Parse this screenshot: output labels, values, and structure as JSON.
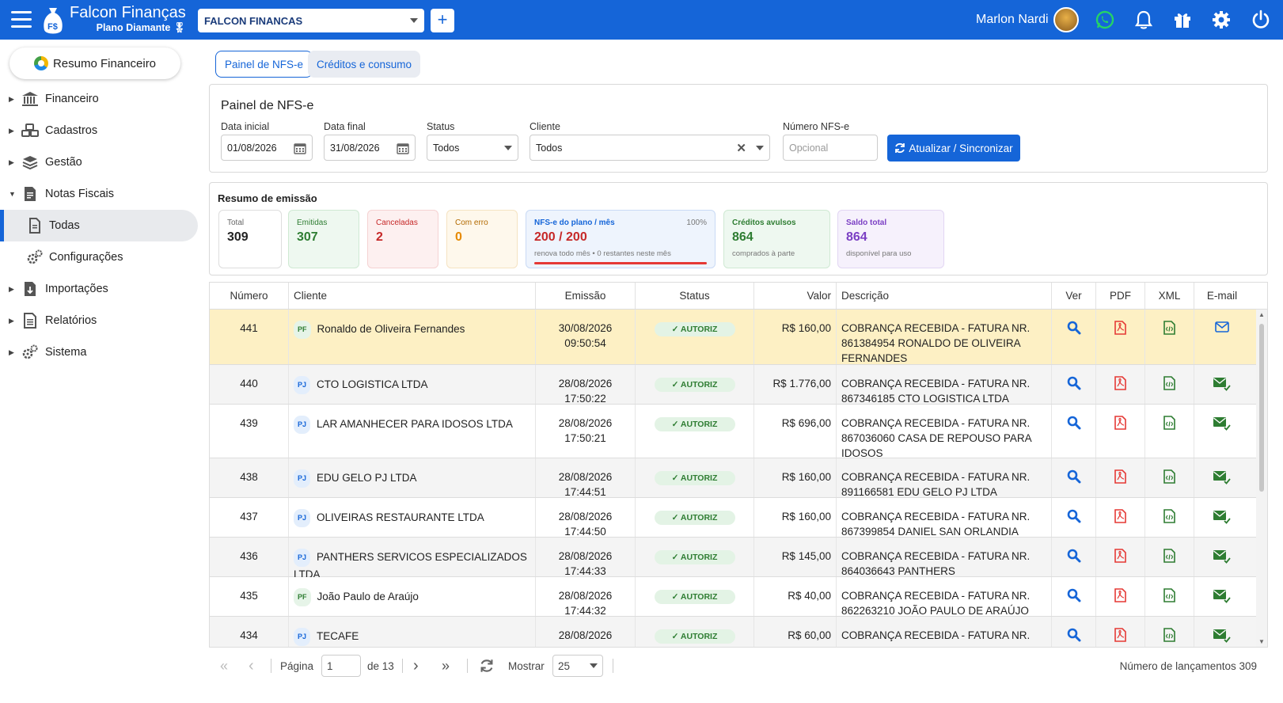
{
  "app": {
    "brand_name": "Falcon Finanças",
    "plan": "Plano Diamante",
    "company": "FALCON FINANCAS",
    "user_name": "Marlon Nardi"
  },
  "sidebar": {
    "resumo": "Resumo Financeiro",
    "items": [
      {
        "label": "Financeiro"
      },
      {
        "label": "Cadastros"
      },
      {
        "label": "Gestão"
      },
      {
        "label": "Notas Fiscais"
      },
      {
        "label": "Todas"
      },
      {
        "label": "Configurações"
      },
      {
        "label": "Importações"
      },
      {
        "label": "Relatórios"
      },
      {
        "label": "Sistema"
      }
    ]
  },
  "tabs": [
    {
      "label": "Painel de NFS-e"
    },
    {
      "label": "Créditos e consumo"
    }
  ],
  "filters": {
    "title": "Painel de NFS-e",
    "data_inicial_label": "Data inicial",
    "data_inicial": "01/08/2026",
    "data_final_label": "Data final",
    "data_final": "31/08/2026",
    "status_label": "Status",
    "status": "Todos",
    "cliente_label": "Cliente",
    "cliente": "Todos",
    "numero_label": "Número NFS-e",
    "numero_placeholder": "Opcional",
    "sync_button": "Atualizar / Sincronizar"
  },
  "summary": {
    "title": "Resumo de emissão",
    "total_label": "Total",
    "total": "309",
    "emitidas_label": "Emitidas",
    "emitidas": "307",
    "canceladas_label": "Canceladas",
    "canceladas": "2",
    "erro_label": "Com erro",
    "erro": "0",
    "plano_label": "NFS-e do plano / mês",
    "plano_pct": "100%",
    "plano_value": "200 / 200",
    "plano_sub": "renova todo mês • 0 restantes neste mês",
    "plano_usage": 1.0,
    "avulsos_label": "Créditos avulsos",
    "avulsos": "864",
    "avulsos_sub": "comprados à parte",
    "saldo_label": "Saldo total",
    "saldo": "864",
    "saldo_sub": "disponível para uso"
  },
  "table": {
    "headers": {
      "numero": "Número",
      "cliente": "Cliente",
      "emissao": "Emissão",
      "status": "Status",
      "valor": "Valor",
      "descricao": "Descrição",
      "ver": "Ver",
      "pdf": "PDF",
      "xml": "XML",
      "email": "E-mail"
    },
    "rows": [
      {
        "numero": "441",
        "tipo": "PF",
        "cliente": "Ronaldo de Oliveira Fernandes",
        "data": "30/08/2026",
        "hora": "09:50:54",
        "status": "✓ AUTORIZ",
        "valor": "R$ 160,00",
        "descricao": "COBRANÇA RECEBIDA - FATURA NR. 861384954 RONALDO DE OLIVEIRA FERNANDES"
      },
      {
        "numero": "440",
        "tipo": "PJ",
        "cliente": "CTO LOGISTICA LTDA",
        "data": "28/08/2026",
        "hora": "17:50:22",
        "status": "✓ AUTORIZ",
        "valor": "R$ 1.776,00",
        "descricao": "COBRANÇA RECEBIDA - FATURA NR. 867346185 CTO LOGISTICA LTDA"
      },
      {
        "numero": "439",
        "tipo": "PJ",
        "cliente": "LAR AMANHECER PARA IDOSOS LTDA",
        "data": "28/08/2026",
        "hora": "17:50:21",
        "status": "✓ AUTORIZ",
        "valor": "R$ 696,00",
        "descricao": "COBRANÇA RECEBIDA - FATURA NR. 867036060 CASA DE REPOUSO PARA IDOSOS"
      },
      {
        "numero": "438",
        "tipo": "PJ",
        "cliente": "EDU GELO PJ LTDA",
        "data": "28/08/2026",
        "hora": "17:44:51",
        "status": "✓ AUTORIZ",
        "valor": "R$ 160,00",
        "descricao": "COBRANÇA RECEBIDA - FATURA NR. 891166581 EDU GELO PJ LTDA"
      },
      {
        "numero": "437",
        "tipo": "PJ",
        "cliente": "OLIVEIRAS RESTAURANTE LTDA",
        "data": "28/08/2026",
        "hora": "17:44:50",
        "status": "✓ AUTORIZ",
        "valor": "R$ 160,00",
        "descricao": "COBRANÇA RECEBIDA - FATURA NR. 867399854 DANIEL SAN ORLANDIA"
      },
      {
        "numero": "436",
        "tipo": "PJ",
        "cliente": "PANTHERS SERVICOS ESPECIALIZADOS LTDA",
        "data": "28/08/2026",
        "hora": "17:44:33",
        "status": "✓ AUTORIZ",
        "valor": "R$ 145,00",
        "descricao": "COBRANÇA RECEBIDA - FATURA NR. 864036643 PANTHERS"
      },
      {
        "numero": "435",
        "tipo": "PF",
        "cliente": "João Paulo de Araújo",
        "data": "28/08/2026",
        "hora": "17:44:32",
        "status": "✓ AUTORIZ",
        "valor": "R$ 40,00",
        "descricao": "COBRANÇA RECEBIDA - FATURA NR. 862263210 JOÃO PAULO DE ARAÚJO"
      },
      {
        "numero": "434",
        "tipo": "PJ",
        "cliente": "TECAFE INCORPORACOES,CONSTRUCOES E",
        "data": "28/08/2026",
        "hora": "",
        "status": "✓ AUTORIZ",
        "valor": "R$ 60,00",
        "descricao": "COBRANÇA RECEBIDA - FATURA NR."
      }
    ]
  },
  "pager": {
    "page_label": "Página",
    "page": "1",
    "of_label": "de 13",
    "show_label": "Mostrar",
    "page_size": "25",
    "count_label": "Número de lançamentos 309"
  },
  "colors": {
    "primary": "#1565d8",
    "highlight_row": "#fdf0c4",
    "stripe_row": "#f4f4f4",
    "success": "#2e7d32",
    "danger": "#e53935"
  }
}
